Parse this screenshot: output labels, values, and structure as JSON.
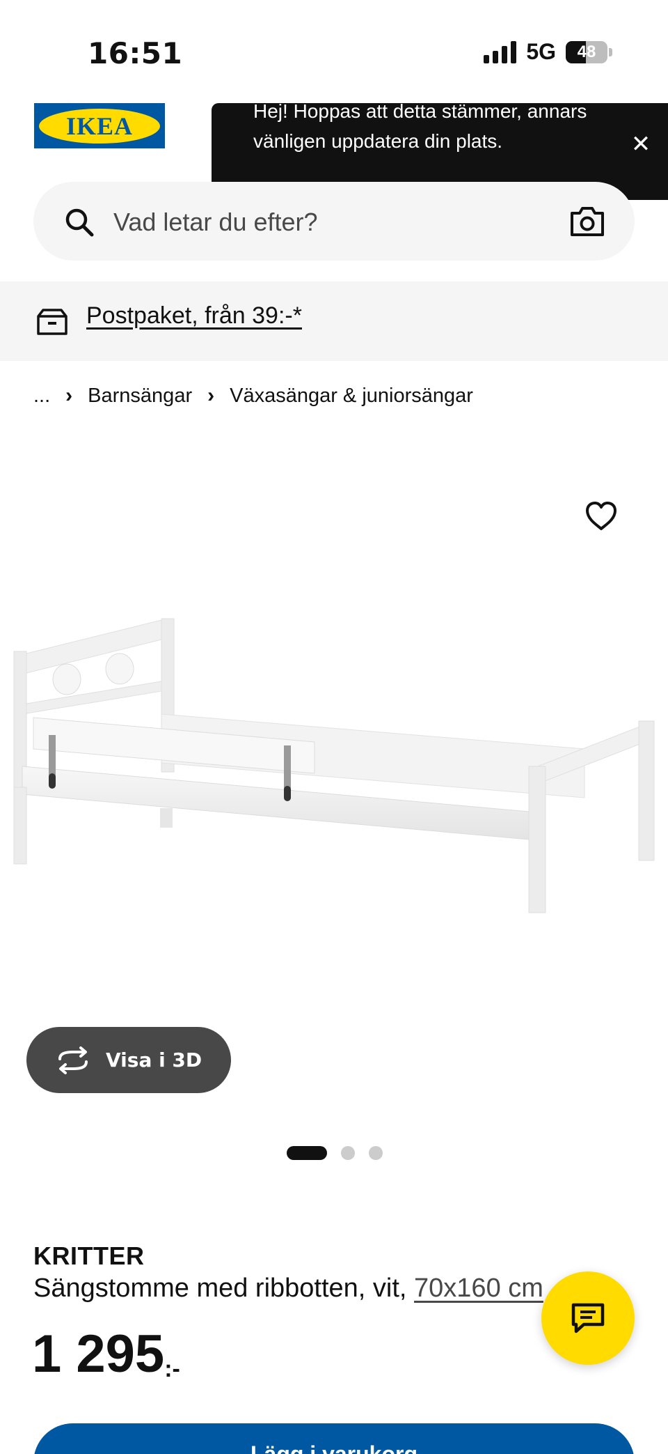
{
  "status_bar": {
    "time": "16:51",
    "network": "5G",
    "battery": "48",
    "battery_level": 0.48
  },
  "header": {
    "logo_text": "IKEA",
    "toast": {
      "message": "Hej! Hoppas att detta stämmer, annars vänligen uppdatera din plats.",
      "close_symbol": "✕"
    },
    "search": {
      "placeholder": "Vad letar du efter?",
      "search_icon": "search-icon",
      "camera_icon": "camera-icon"
    }
  },
  "shipping_banner": {
    "icon": "package-icon",
    "text": "Postpaket, från 39:-*"
  },
  "breadcrumb": {
    "items": [
      "...",
      "Barnsängar",
      "Växasängar & juniorsängar"
    ],
    "separator": "›"
  },
  "product_media": {
    "favorite_icon": "heart-icon",
    "view3d_label": "Visa i 3D",
    "view3d_icon": "rotate-icon",
    "carousel": {
      "count": 3,
      "active": 0
    }
  },
  "product": {
    "name": "KRITTER",
    "description": "Sängstomme med ribbotten, vit, ",
    "size_link": "70x160 cm",
    "price_integer": "1 295",
    "price_suffix": ":-"
  },
  "chat": {
    "icon": "chat-icon"
  },
  "cart_button": {
    "label": "Lägg i varukorg"
  },
  "colors": {
    "ikea_blue": "#0058a3",
    "ikea_yellow": "#ffdb00",
    "toast_bg": "#111111",
    "view3d_bg": "#484848",
    "banner_bg": "#f5f5f5"
  }
}
